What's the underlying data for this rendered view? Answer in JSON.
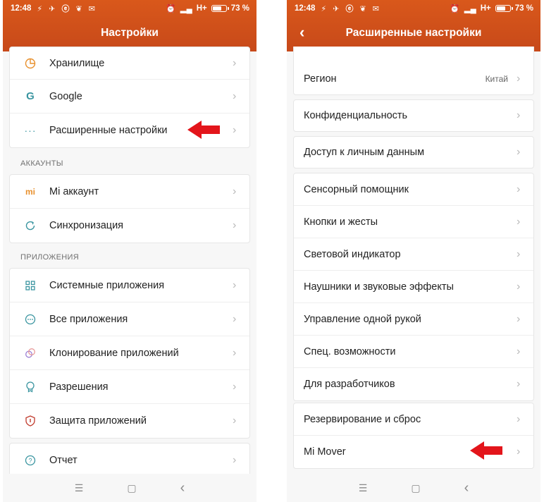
{
  "status_bar": {
    "time": "12:48",
    "icons": "⚡ ✈ ⓔ ❦ ✉",
    "network": "H+",
    "battery": "73 %",
    "battery_level": 0.73
  },
  "left_screen": {
    "title": "Настройки",
    "group1": [
      {
        "label": "Хранилище",
        "icon": "storage-icon"
      },
      {
        "label": "Google",
        "icon": "google-icon"
      },
      {
        "label": "Расширенные настройки",
        "icon": "more-dots-icon"
      }
    ],
    "section_accounts": "АККАУНТЫ",
    "group2": [
      {
        "label": "Mi аккаунт",
        "icon": "mi-icon"
      },
      {
        "label": "Синхронизация",
        "icon": "sync-icon"
      }
    ],
    "section_apps": "ПРИЛОЖЕНИЯ",
    "group3": [
      {
        "label": "Системные приложения",
        "icon": "grid-icon"
      },
      {
        "label": "Все приложения",
        "icon": "apps-circle-icon"
      },
      {
        "label": "Клонирование приложений",
        "icon": "clone-icon"
      },
      {
        "label": "Разрешения",
        "icon": "permissions-icon"
      },
      {
        "label": "Защита приложений",
        "icon": "shield-icon"
      }
    ],
    "group4": [
      {
        "label": "Отчет",
        "icon": "help-icon"
      }
    ]
  },
  "right_screen": {
    "title": "Расширенные настройки",
    "group1": [
      {
        "label": "Регион",
        "value": "Китай"
      }
    ],
    "group2": [
      {
        "label": "Конфиденциальность"
      }
    ],
    "group3": [
      {
        "label": "Доступ к личным данным"
      }
    ],
    "group4": [
      {
        "label": "Сенсорный помощник"
      },
      {
        "label": "Кнопки и жесты"
      },
      {
        "label": "Световой индикатор"
      },
      {
        "label": "Наушники и звуковые эффекты"
      },
      {
        "label": "Управление одной рукой"
      },
      {
        "label": "Спец. возможности"
      },
      {
        "label": "Для разработчиков"
      }
    ],
    "group5": [
      {
        "label": "Резервирование и сброс"
      },
      {
        "label": "Mi Mover"
      }
    ]
  },
  "nav": {
    "menu": "☰",
    "home": "▢",
    "back": "‹"
  },
  "chevron": "›",
  "colors": {
    "accent": "#d0521b",
    "arrow": "#e3151b",
    "icon": "#3a95a0",
    "orange_icon": "#e8902d"
  }
}
